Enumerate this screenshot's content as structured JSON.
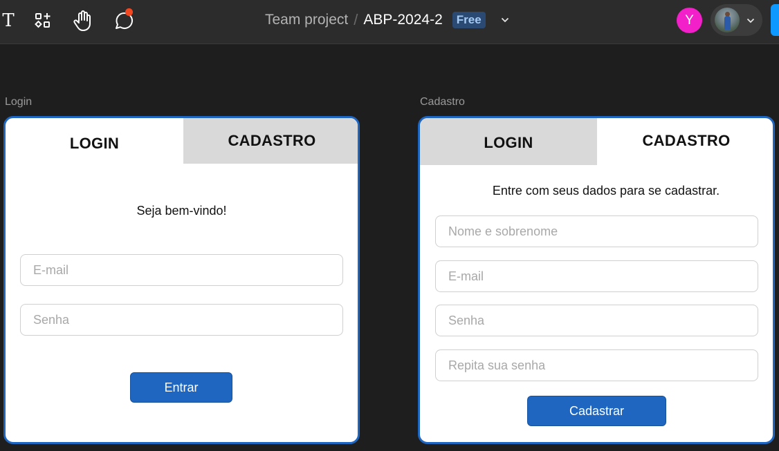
{
  "toolbar": {
    "text_tool_glyph": "T",
    "icons": [
      "text-tool-icon",
      "resources-icon",
      "hand-tool-icon",
      "comment-icon"
    ],
    "breadcrumb": {
      "team": "Team project",
      "separator": "/",
      "file": "ABP-2024-2",
      "plan_badge": "Free"
    },
    "user_initial": "Y",
    "colors": {
      "avatar": "#f220c8",
      "notification": "#f24822",
      "share": "#0d99ff",
      "badge_bg": "#2a4a74"
    }
  },
  "frames": {
    "login": {
      "label": "Login",
      "tabs": {
        "login": "LOGIN",
        "cadastro": "CADASTRO"
      },
      "welcome": "Seja bem-vindo!",
      "email_placeholder": "E-mail",
      "password_placeholder": "Senha",
      "submit_label": "Entrar"
    },
    "cadastro": {
      "label": "Cadastro",
      "tabs": {
        "login": "LOGIN",
        "cadastro": "CADASTRO"
      },
      "intro": "Entre com seus dados para se cadastrar.",
      "name_placeholder": "Nome e sobrenome",
      "email_placeholder": "E-mail",
      "password_placeholder": "Senha",
      "repeat_password_placeholder": "Repita sua senha",
      "submit_label": "Cadastrar"
    },
    "colors": {
      "accent": "#1f66c0",
      "inactive_tab": "#d9d9d9"
    }
  }
}
